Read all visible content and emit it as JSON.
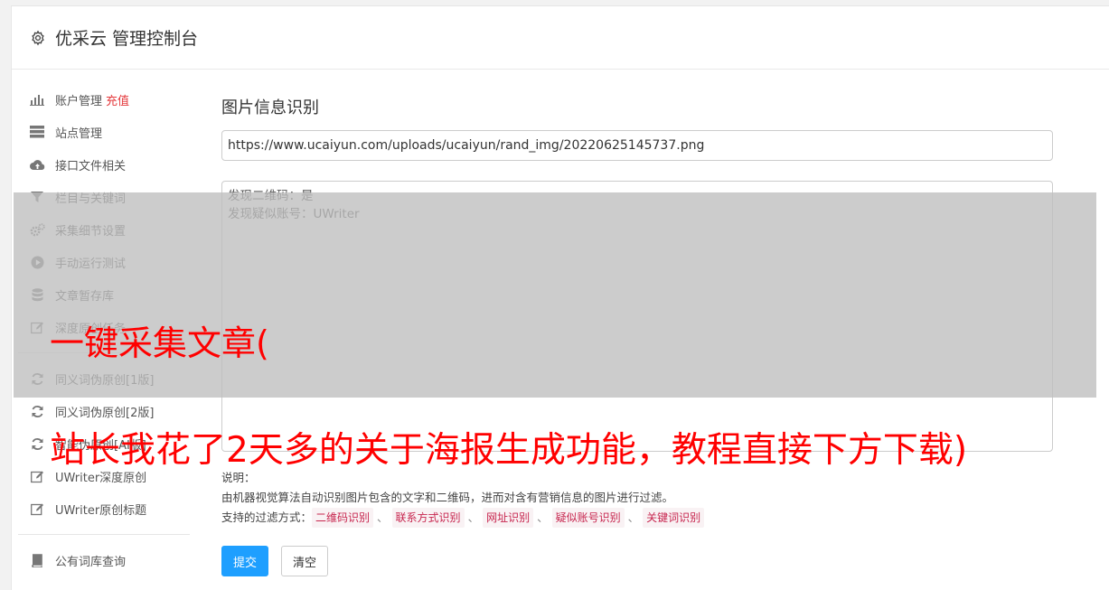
{
  "header": {
    "title": "优采云 管理控制台"
  },
  "sidebar": {
    "items": [
      {
        "label": "账户管理",
        "badge": "充值",
        "icon": "bar-chart-icon"
      },
      {
        "label": "站点管理",
        "icon": "server-icon"
      },
      {
        "label": "接口文件相关",
        "icon": "cloud-upload-icon"
      },
      {
        "label": "栏目与关键词",
        "icon": "filter-icon"
      },
      {
        "label": "采集细节设置",
        "icon": "gears-icon"
      },
      {
        "label": "手动运行测试",
        "icon": "play-circle-icon"
      },
      {
        "label": "文章暂存库",
        "icon": "database-icon"
      },
      {
        "label": "深度原创任务",
        "icon": "edit-icon"
      }
    ],
    "items2": [
      {
        "label": "同义词伪原创[1版]",
        "icon": "refresh-icon"
      },
      {
        "label": "同义词伪原创[2版]",
        "icon": "refresh-icon"
      },
      {
        "label": "智能伪原创[AI版]",
        "icon": "refresh-icon"
      },
      {
        "label": "UWriter深度原创",
        "icon": "edit-icon"
      },
      {
        "label": "UWriter原创标题",
        "icon": "edit-icon"
      }
    ],
    "items3": [
      {
        "label": "公有词库查询",
        "icon": "book-icon"
      }
    ]
  },
  "main": {
    "section_title": "图片信息识别",
    "url_value": "https://www.ucaiyun.com/uploads/ucaiyun/rand_img/20220625145737.png",
    "result_text": "发现二维码：是\n发现疑似账号：UWriter",
    "desc_label": "说明：",
    "desc_text": "由机器视觉算法自动识别图片包含的文字和二维码，进而对含有营销信息的图片进行过滤。",
    "filters_label": "支持的过滤方式：",
    "filters": [
      "二维码识别",
      "联系方式识别",
      "网址识别",
      "疑似账号识别",
      "关键词识别"
    ],
    "filter_sep": "、",
    "submit_label": "提交",
    "clear_label": "清空"
  },
  "watermark": {
    "line1": "一键采集文章(",
    "line2": "站长我花了2天多的关于海报生成功能，教程直接下方下载)"
  },
  "colors": {
    "primary": "#1e9fff",
    "badge": "#e4393c",
    "code_text": "#c7254e",
    "code_bg": "#f9f2f4",
    "watermark": "#ff0000"
  }
}
